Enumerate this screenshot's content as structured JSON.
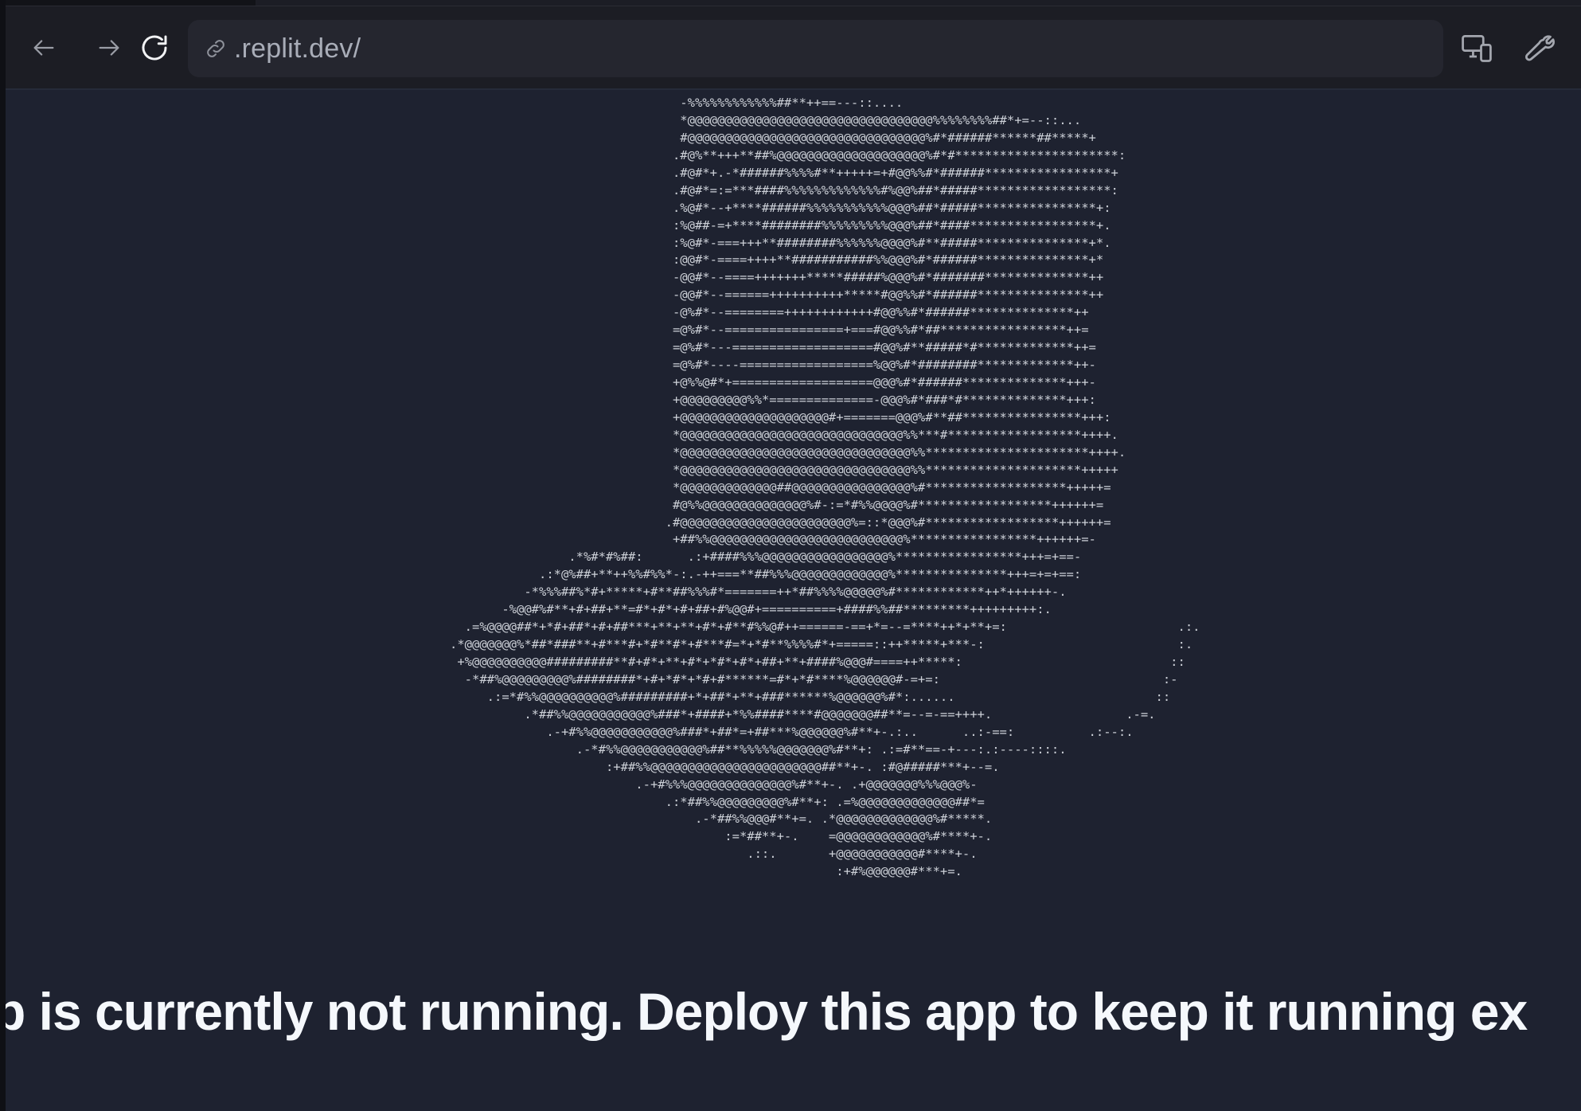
{
  "browser": {
    "url": ".replit.dev/",
    "icons": {
      "back": "arrow-left-icon",
      "forward": "arrow-right-icon",
      "reload": "reload-icon",
      "link": "link-icon",
      "devices": "responsive-devices-icon",
      "devtools": "wrench-icon"
    }
  },
  "ascii_art": {
    "lines": [
      "                               -%%%%%%%%%%%%##**++==---::....",
      "                               *@@@@@@@@@@@@@@@@@@@@@@@@@@@@@@@@@%%%%%%%%##*+=--::...",
      "                               #@@@@@@@@@@@@@@@@@@@@@@@@@@@@@@@@%#*######******##*****+",
      "                              .#@%**+++**##%@@@@@@@@@@@@@@@@@@@@%#*#**********************:",
      "                              .#@#*+.-*######%%%%#**+++++=+#@@%%#*######*****************+",
      "                              .#@#*=:=***####%%%%%%%%%%%%%#%@@%##*#####******************:",
      "                              .%@#*--+****######%%%%%%%%%%%@@@%##*#####****************+:",
      "                              :%@##-=+****########%%%%%%%%%@@@%##*####*****************+.",
      "                              :%@#*-===+++**########%%%%%%@@@@%#**#####***************+*.",
      "                              :@@#*-====++++**###########%%@@@%#*######***************+*",
      "                              -@@#*--====+++++++*****#####%@@@%#*#######**************++",
      "                              -@@#*--======++++++++++*****#@@%%#*######***************++",
      "                              -@%#*--========++++++++++++#@@%%#*######**************++",
      "                              =@%#*--================+===#@@%%#*##*****************++=",
      "                              =@%#*---===================#@@%#**#####*#*************++=",
      "                              =@%#*----==================%@@%#*########*************++-",
      "                              +@%%@#*+===================@@@%#*######**************+++-",
      "                              +@@@@@@@@@%%*==============-@@@%#*###*#**************+++:",
      "                              +@@@@@@@@@@@@@@@@@@@@#+=======@@@%#**##****************+++:",
      "                              *@@@@@@@@@@@@@@@@@@@@@@@@@@@@@@%%***#******************++++.",
      "                              *@@@@@@@@@@@@@@@@@@@@@@@@@@@@@@@%%**********************++++.",
      "                              *@@@@@@@@@@@@@@@@@@@@@@@@@@@@@@@%%*********************+++++",
      "                              *@@@@@@@@@@@@@##@@@@@@@@@@@@@@@@%#*******************+++++=",
      "                              #@%%@@@@@@@@@@@@@@%#-:=*#%%@@@@%#******************++++++=",
      "                             .#@@@@@@@@@@@@@@@@@@@@@@@%=::*@@@%#******************++++++=",
      "                              +##%%@@@@@@@@@@@@@@@@@@@@@@@@@@%*****************++++++=-",
      "                .*%#*#%##:      .:+####%%%@@@@@@@@@@@@@@@@@%*****************+++=+==-",
      "            .:*@%##+**++%%#%%*-:.-++===**##%%%@@@@@@@@@@@@@%***************+++=+=+==:",
      "          -*%%%##%*#+*****+#**##%%%#*=======++*##%%%%@@@@@%#************++*++++++-.",
      "       -%@@#%#**+#+##+**=#*+#*+#+##+#%@@#+==========+####%%##*********+++++++++:.",
      "  .=%@@@@##*+*#+##*+#+##***+**+**+#*+#**#%%@#++======-==+*=--=****++*+**+=:",
      ".*@@@@@@@%*##*###**+#***#+*#**#*+#***#=*+*#**%%%%#*+=====::++*****+***-:",
      " +%@@@@@@@@@@#########**#+#*+**+#*+*#*+#*+##+**+####%@@@#====++*****:",
      "  -*##%@@@@@@@@@%########*+#+*#*+*#+#******=#*+*#****%@@@@@@#-=+=:",
      "     .:=*#%%@@@@@@@@@@%#########+*+##*+**+###******%@@@@@@%#*:......",
      "          .*##%%@@@@@@@@@@@%###*+####+*%%####****#@@@@@@@##**=--=-==++++.",
      "             .-+#%%@@@@@@@@@@@%###*+##*=+##***%@@@@@@%#**+-.:..",
      "                 .-*#%%@@@@@@@@@@@%##**%%%%%@@@@@@@%#**+: .:=#**==-+---:.:----::::.",
      "                     :+##%%@@@@@@@@@@@@@@@@@@@@@@@##**+-. :#@#####***+--=.",
      "                         .-+#%%%@@@@@@@@@@@@@@%#**+-. .+@@@@@@@%%%@@@%-",
      "                             .:*##%%@@@@@@@@@%#**+: .=%@@@@@@@@@@@@@##*=",
      "                                 .-*##%%@@@#**+=. .*@@@@@@@@@@@@@%#*****.",
      "                                     :=*##**+-.    =@@@@@@@@@@@@%#****+-.",
      "                                        .::.       +@@@@@@@@@@@#****+-.",
      "                                                    :+#%@@@@@@#***+=."
    ],
    "handle": [
      {
        "line": 30,
        "text": ".:."
      },
      {
        "line": 31,
        "text": ":."
      },
      {
        "line": 32,
        "text": "::"
      },
      {
        "line": 33,
        "text": ":-"
      },
      {
        "line": 34,
        "text": "::"
      },
      {
        "line": 35,
        "text": ".-=."
      },
      {
        "line": 36,
        "text": "..:-==:"
      },
      {
        "line": 36,
        "text": ".:--:."
      }
    ]
  },
  "message": "p is currently not running. Deploy this app to keep it running ex"
}
